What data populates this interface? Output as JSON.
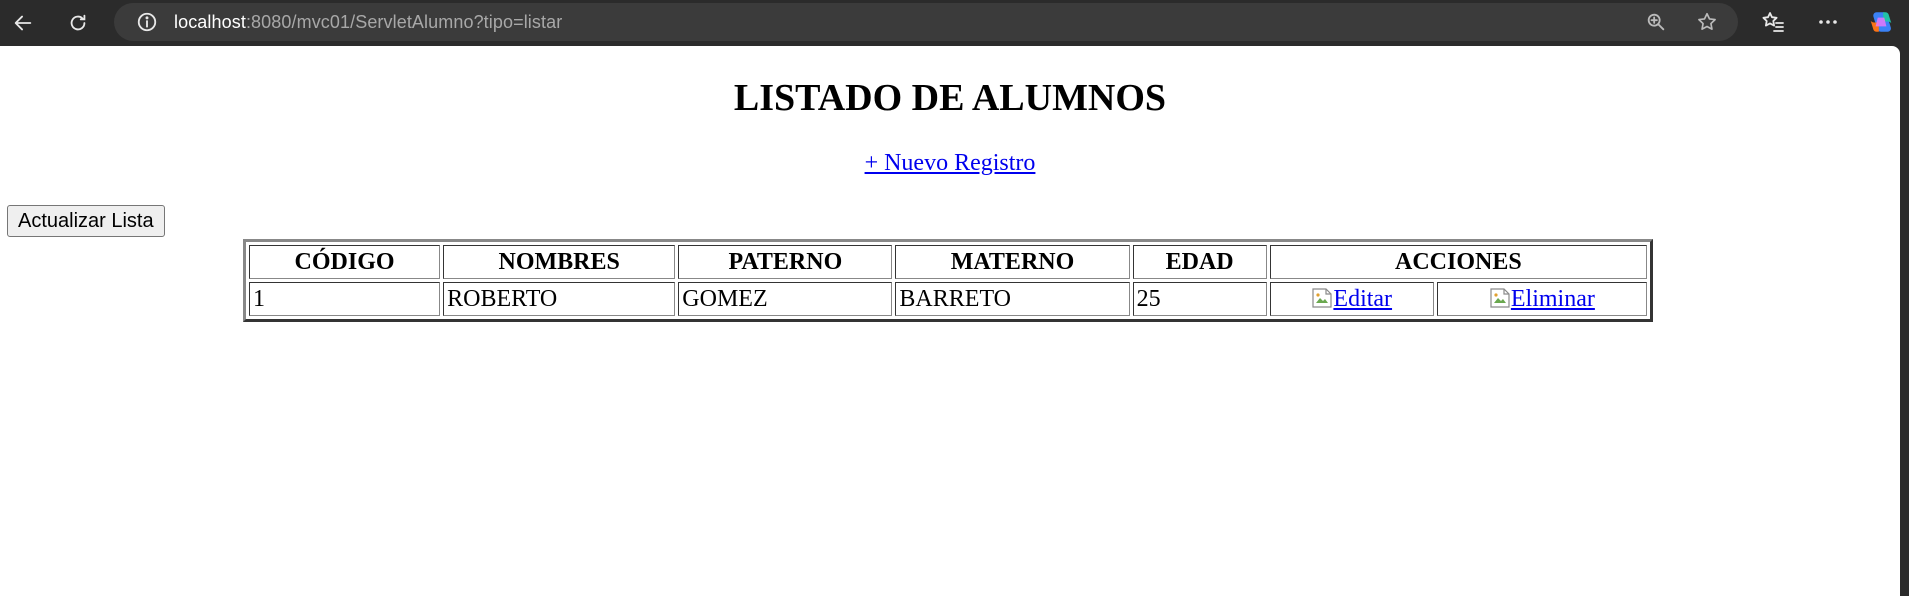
{
  "browser": {
    "url_host": "localhost",
    "url_rest": ":8080/mvc01/ServletAlumno?tipo=listar"
  },
  "page": {
    "title": "LISTADO DE ALUMNOS",
    "new_link": "+ Nuevo Registro",
    "refresh_button": "Actualizar Lista"
  },
  "table": {
    "headers": {
      "codigo": "CÓDIGO",
      "nombres": "NOMBRES",
      "paterno": "PATERNO",
      "materno": "MATERNO",
      "edad": "EDAD",
      "acciones": "ACCIONES"
    },
    "rows": [
      {
        "codigo": "1",
        "nombres": "ROBERTO",
        "paterno": "GOMEZ",
        "materno": "BARRETO",
        "edad": "25",
        "edit": "Editar",
        "delete": "Eliminar"
      }
    ]
  }
}
